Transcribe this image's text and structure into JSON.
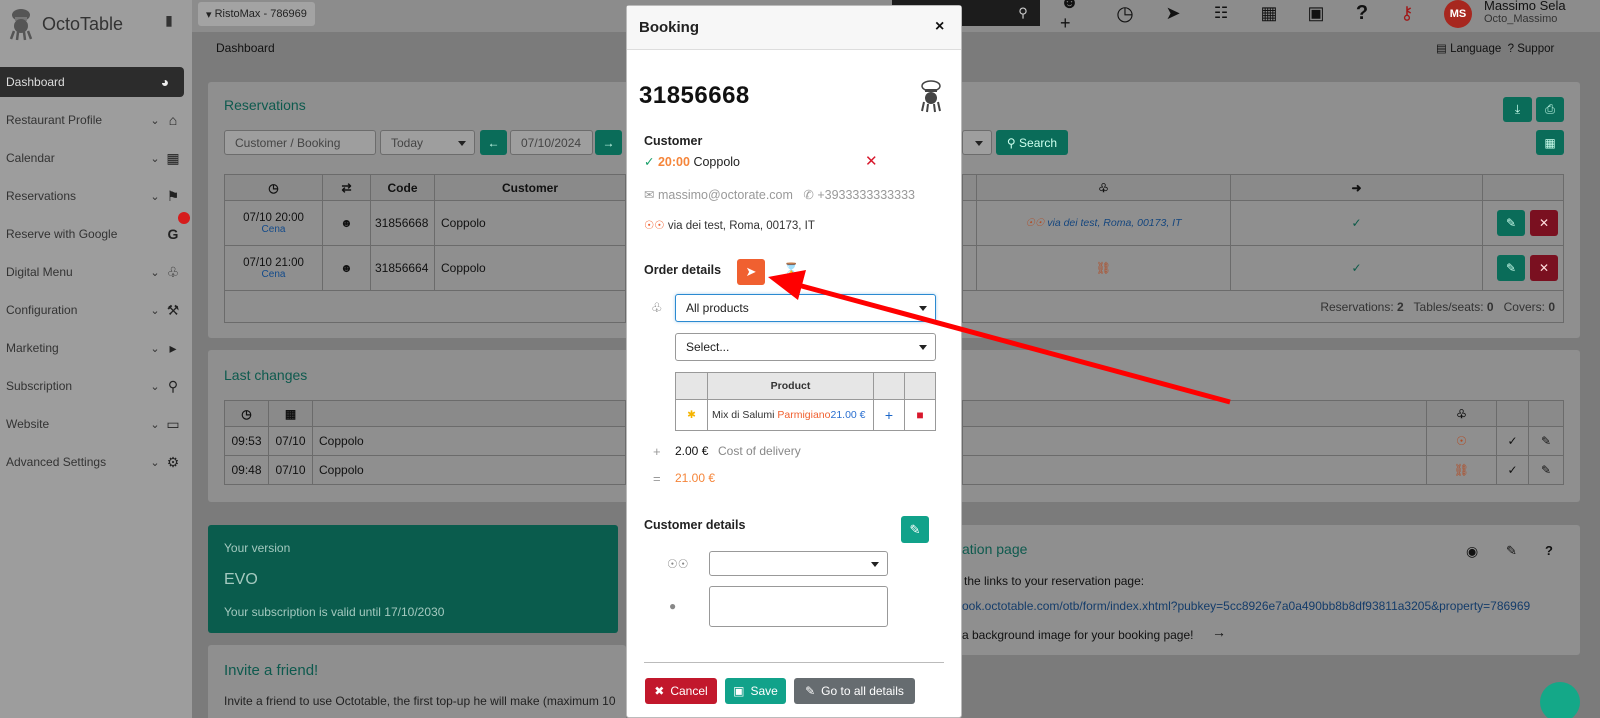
{
  "app": {
    "name": "OctoTable"
  },
  "topbar": {
    "restaurant": "RistoMax - 786969",
    "user_name": "Massimo Sela",
    "user_handle": "Octo_Massimo",
    "avatar_initials": "MS",
    "language_label": "Language",
    "support_label": "Suppor"
  },
  "breadcrumb": "Dashboard",
  "sidebar": {
    "items": [
      {
        "label": "Dashboard",
        "icon": "dashboard-icon"
      },
      {
        "label": "Restaurant Profile",
        "icon": "home-icon"
      },
      {
        "label": "Calendar",
        "icon": "calendar-icon"
      },
      {
        "label": "Reservations",
        "icon": "flag-icon"
      },
      {
        "label": "Reserve with Google",
        "icon": "google-icon"
      },
      {
        "label": "Digital Menu",
        "icon": "utensils-icon"
      },
      {
        "label": "Configuration",
        "icon": "wrench-icon"
      },
      {
        "label": "Marketing",
        "icon": "megaphone-icon"
      },
      {
        "label": "Subscription",
        "icon": "cart-icon"
      },
      {
        "label": "Website",
        "icon": "monitor-icon"
      },
      {
        "label": "Advanced Settings",
        "icon": "cogs-icon"
      }
    ]
  },
  "reservations": {
    "title": "Reservations",
    "search_placeholder": "Customer / Booking",
    "period": "Today",
    "date": "07/10/2024",
    "search_label": "Search",
    "columns": [
      "Code",
      "Customer"
    ],
    "rows": [
      {
        "time": "07/10 20:00",
        "service": "Cena",
        "code": "31856668",
        "customer": "Coppolo",
        "address": "via dei test, Roma, 00173, IT"
      },
      {
        "time": "07/10 21:00",
        "service": "Cena",
        "code": "31856664",
        "customer": "Coppolo"
      }
    ],
    "footer": {
      "reservations_label": "Reservations:",
      "reservations": "2",
      "tables_label": "Tables/seats:",
      "tables": "0",
      "covers_label": "Covers:",
      "covers": "0"
    }
  },
  "last_changes": {
    "title": "Last changes",
    "rows": [
      {
        "time": "09:53",
        "date": "07/10",
        "customer": "Coppolo"
      },
      {
        "time": "09:48",
        "date": "07/10",
        "customer": "Coppolo"
      }
    ]
  },
  "version": {
    "label": "Your version",
    "name": "EVO",
    "validity": "Your subscription is valid until 17/10/2030"
  },
  "reservation_page": {
    "title": "ation page",
    "links_text": "the links to your reservation page:",
    "url": "ook.octotable.com/otb/form/index.xhtml?pubkey=5cc8926e7a0a490bb8b8df93811a3205&property=786969",
    "bg_text": "a background image for your booking page!"
  },
  "invite": {
    "title": "Invite a friend!",
    "text": "Invite a friend to use Octotable, the first top-up he will make (maximum 10"
  },
  "modal": {
    "title": "Booking",
    "booking_code": "31856668",
    "customer_heading": "Customer",
    "time": "20:00",
    "customer_name": "Coppolo",
    "email": "massimo@octorate.com",
    "phone": "+3933333333333",
    "address": "via dei test, Roma, 00173, IT",
    "order_heading": "Order details",
    "product_filter": "All products",
    "select_placeholder": "Select...",
    "product_col": "Product",
    "product": {
      "name": "Mix di Salumi",
      "variant": "Parmigiano",
      "price": "21.00 €"
    },
    "delivery_sign": "+",
    "delivery_cost": "2.00 €",
    "delivery_label": "Cost of delivery",
    "total_sign": "=",
    "total": "21.00 €",
    "customer_details_heading": "Customer details",
    "cancel_label": "Cancel",
    "save_label": "Save",
    "details_label": "Go to all details"
  },
  "colors": {
    "accent": "#11a28a",
    "danger": "#c2182c",
    "orange": "#f06030",
    "arrow": "#ff0000"
  }
}
